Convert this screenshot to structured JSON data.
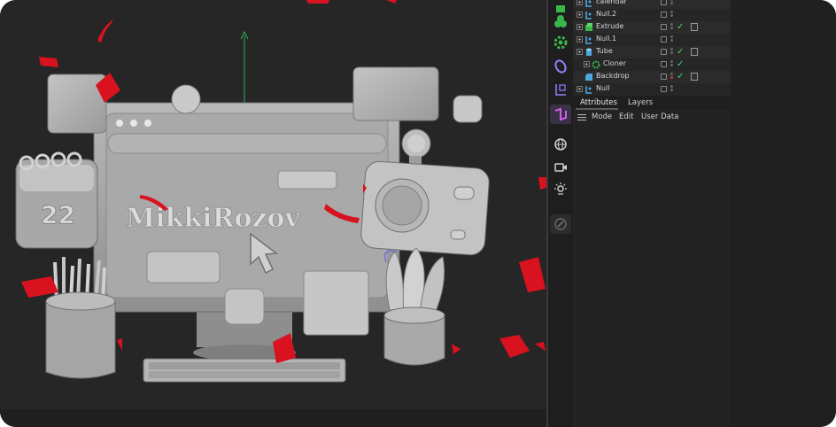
{
  "viewport": {
    "watermark_text": "MikkiRozov",
    "calendar_day": "22"
  },
  "objects": [
    {
      "name": "calendar",
      "icon": "null-icon",
      "indent": 0,
      "has_check": false,
      "has_tag": false
    },
    {
      "name": "Null.2",
      "icon": "null-icon",
      "indent": 0,
      "has_check": false,
      "has_tag": false
    },
    {
      "name": "Extrude",
      "icon": "extrude-icon",
      "indent": 0,
      "has_check": true,
      "has_tag": true
    },
    {
      "name": "Null.1",
      "icon": "null-icon",
      "indent": 0,
      "has_check": false,
      "has_tag": false
    },
    {
      "name": "Tube",
      "icon": "tube-icon",
      "indent": 0,
      "has_check": true,
      "has_tag": true
    },
    {
      "name": "Cloner",
      "icon": "cloner-icon",
      "indent": 1,
      "has_check": true,
      "has_tag": false
    },
    {
      "name": "Backdrop",
      "icon": "backdrop-icon",
      "indent": 1,
      "has_check": true,
      "has_tag": true
    },
    {
      "name": "Null",
      "icon": "null-icon",
      "indent": 0,
      "has_check": false,
      "has_tag": false
    }
  ],
  "attributes": {
    "tabs": [
      "Attributes",
      "Layers"
    ],
    "menu": [
      "Mode",
      "Edit",
      "User Data"
    ]
  },
  "colors": {
    "accent_green": "#49d26b",
    "confetti_red": "#d8121f",
    "object_blue": "#4aa8e0"
  }
}
